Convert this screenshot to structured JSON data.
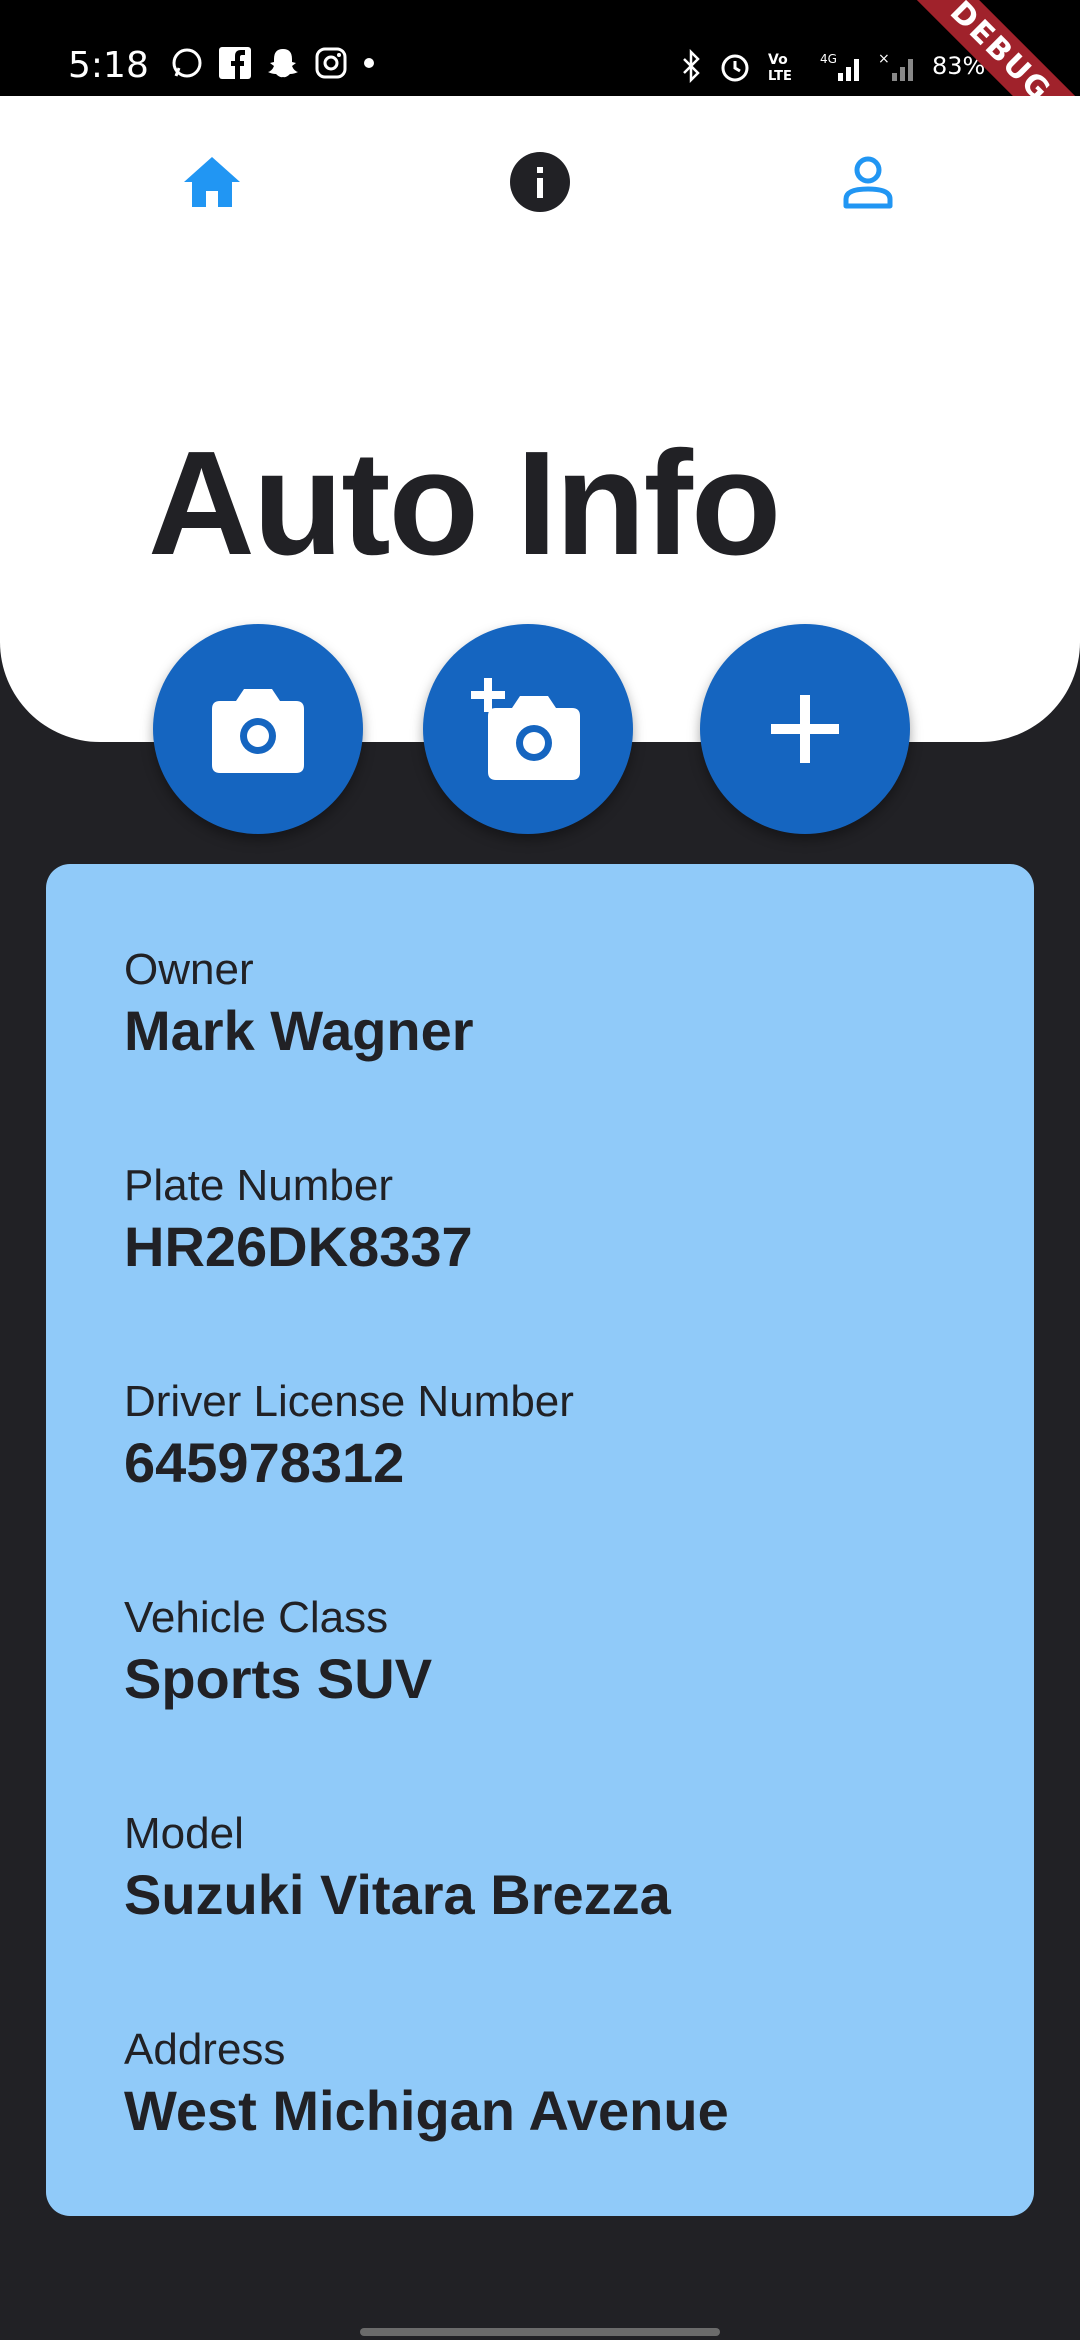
{
  "status_bar": {
    "time": "5:18",
    "battery": "83%",
    "app_icons": [
      "whatsapp-icon",
      "facebook-icon",
      "snapchat-icon",
      "instagram-icon"
    ],
    "system_icons": [
      "bluetooth-icon",
      "alarm-icon",
      "volte-icon",
      "signal-icon",
      "battery-icon"
    ]
  },
  "debug_banner": "DEBUG",
  "nav": {
    "items": [
      {
        "icon": "home-icon",
        "color": "#2196f3"
      },
      {
        "icon": "info-icon",
        "color": "#212125"
      },
      {
        "icon": "person-icon",
        "color": "#2196f3"
      }
    ]
  },
  "title": "Auto Info",
  "actions": [
    {
      "icon": "camera-icon"
    },
    {
      "icon": "add-photo-icon"
    },
    {
      "icon": "add-icon"
    }
  ],
  "details": [
    {
      "label": "Owner",
      "value": "Mark Wagner"
    },
    {
      "label": "Plate Number",
      "value": "HR26DK8337"
    },
    {
      "label": "Driver License Number",
      "value": "645978312"
    },
    {
      "label": "Vehicle Class",
      "value": "Sports SUV"
    },
    {
      "label": "Model",
      "value": "Suzuki Vitara Brezza"
    },
    {
      "label": "Address",
      "value": "West Michigan Avenue"
    }
  ],
  "colors": {
    "background": "#212125",
    "header": "#ffffff",
    "accent": "#1565c0",
    "card": "#90caf9",
    "nav_active": "#2196f3"
  }
}
